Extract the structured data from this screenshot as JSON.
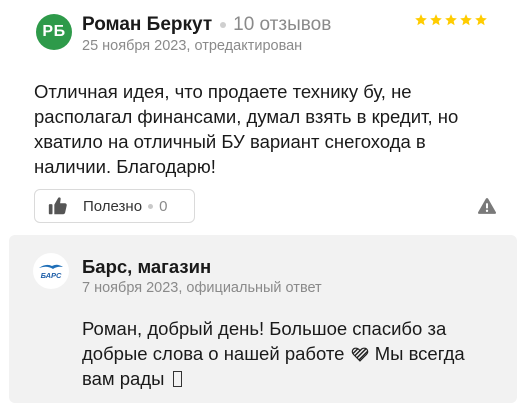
{
  "review": {
    "avatar_initials": "РБ",
    "avatar_color": "#2e9a4a",
    "author": "Роман Беркут",
    "reviews_count": "10 отзывов",
    "date": "25 ноября 2023, отредактирован",
    "rating": 5,
    "star_color": "#fc0",
    "text": "Отличная идея, что продаете технику бу, не располагал финансами, думал взять в кредит, но хватило на отличный БУ вариант снегохода в наличии. Благодарю!",
    "useful_label": "Полезно",
    "useful_count": "0",
    "icons": {
      "useful": "thumbs-up-icon",
      "report": "warning-icon"
    }
  },
  "reply": {
    "logo_text": "БАРС",
    "name": "Барс, магазин",
    "date": "7 ноября 2023, официальный ответ",
    "text_before_heart": "Роман, добрый день! Большое спасибо за добрые слова о нашей работе",
    "text_after_heart": "Мы всегда вам рады",
    "icons": {
      "heart": "heart-icon",
      "missing": "missing-glyph-icon"
    },
    "background": "#f2f2f2"
  }
}
